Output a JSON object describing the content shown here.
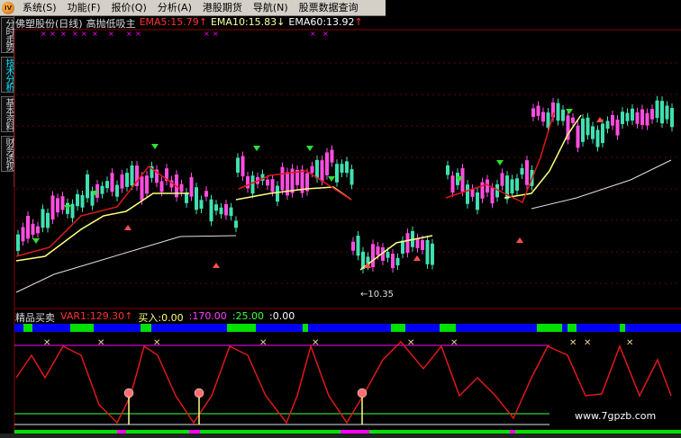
{
  "menu": {
    "logo": "IV",
    "items": [
      "系统",
      "功能",
      "报价",
      "分析",
      "港股期货",
      "导航",
      "股票数据查询"
    ],
    "keys": [
      "(S)",
      "(F)",
      "(Q)",
      "(A)",
      "",
      "(N)",
      ""
    ]
  },
  "sidetabs": [
    "分时走势",
    "技术分析",
    "基本资料",
    "财务透视"
  ],
  "legend": {
    "title": "佛塑股份(日线)",
    "indicator": "高抛低吸主",
    "ema5": "EMA5:15.79",
    "ema10": "EMA10:15.83",
    "ema60": "EMA60:13.92",
    "up_arrow": "↑",
    "down_arrow": "↓"
  },
  "price_annotation": "←10.35",
  "lower": {
    "title": "精品买卖",
    "var1": "VAR1:129.30",
    "arrow": "↑",
    "buy": "买入:0.00",
    "v1": ":170.00",
    "v2": ":25.00",
    "v3": ":0.00"
  },
  "colors": {
    "up_candle": "#ff4de0",
    "down_candle": "#40e0b0",
    "ema_short": "#e01818",
    "ema_mid": "#ffff80",
    "ema_long": "#e0e0e0",
    "signal_blue": "#0000f0",
    "signal_green": "#00e000",
    "signal_magenta": "#ff00ff"
  },
  "watermark": "www.7gpzb.com"
}
